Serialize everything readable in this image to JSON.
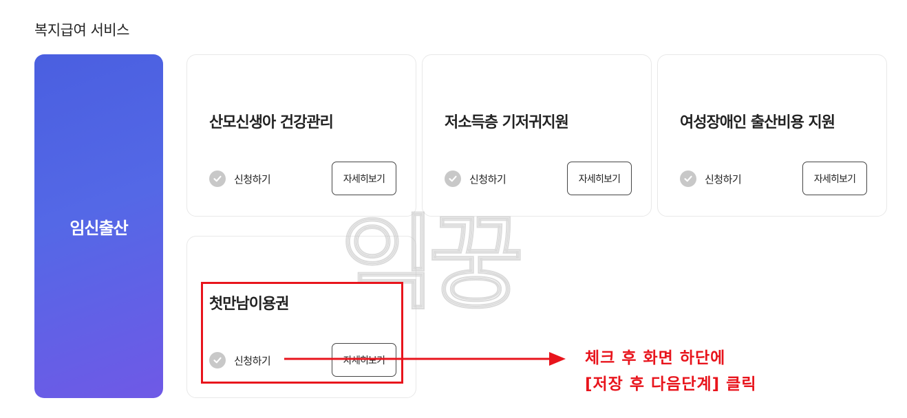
{
  "section": {
    "title": "복지급여 서비스"
  },
  "category": {
    "label": "임신출산",
    "gradient_start": "#4a5fe0",
    "gradient_end": "#6f59e6"
  },
  "cards": [
    {
      "title": "산모신생아 건강관리",
      "apply_label": "신청하기",
      "detail_label": "자세히보기"
    },
    {
      "title": "저소득층 기저귀지원",
      "apply_label": "신청하기",
      "detail_label": "자세히보기"
    },
    {
      "title": "여성장애인 출산비용 지원",
      "apply_label": "신청하기",
      "detail_label": "자세히보기"
    },
    {
      "title": "첫만남이용권",
      "apply_label": "신청하기",
      "detail_label": "자세히보기"
    }
  ],
  "watermark": {
    "text": "익꿍"
  },
  "annotation": {
    "line1": "체크 후 화면 하단에",
    "line2": "[저장 후 다음단계] 클릭",
    "color": "#e8141c"
  },
  "icons": {
    "check": "check-circle-icon"
  }
}
